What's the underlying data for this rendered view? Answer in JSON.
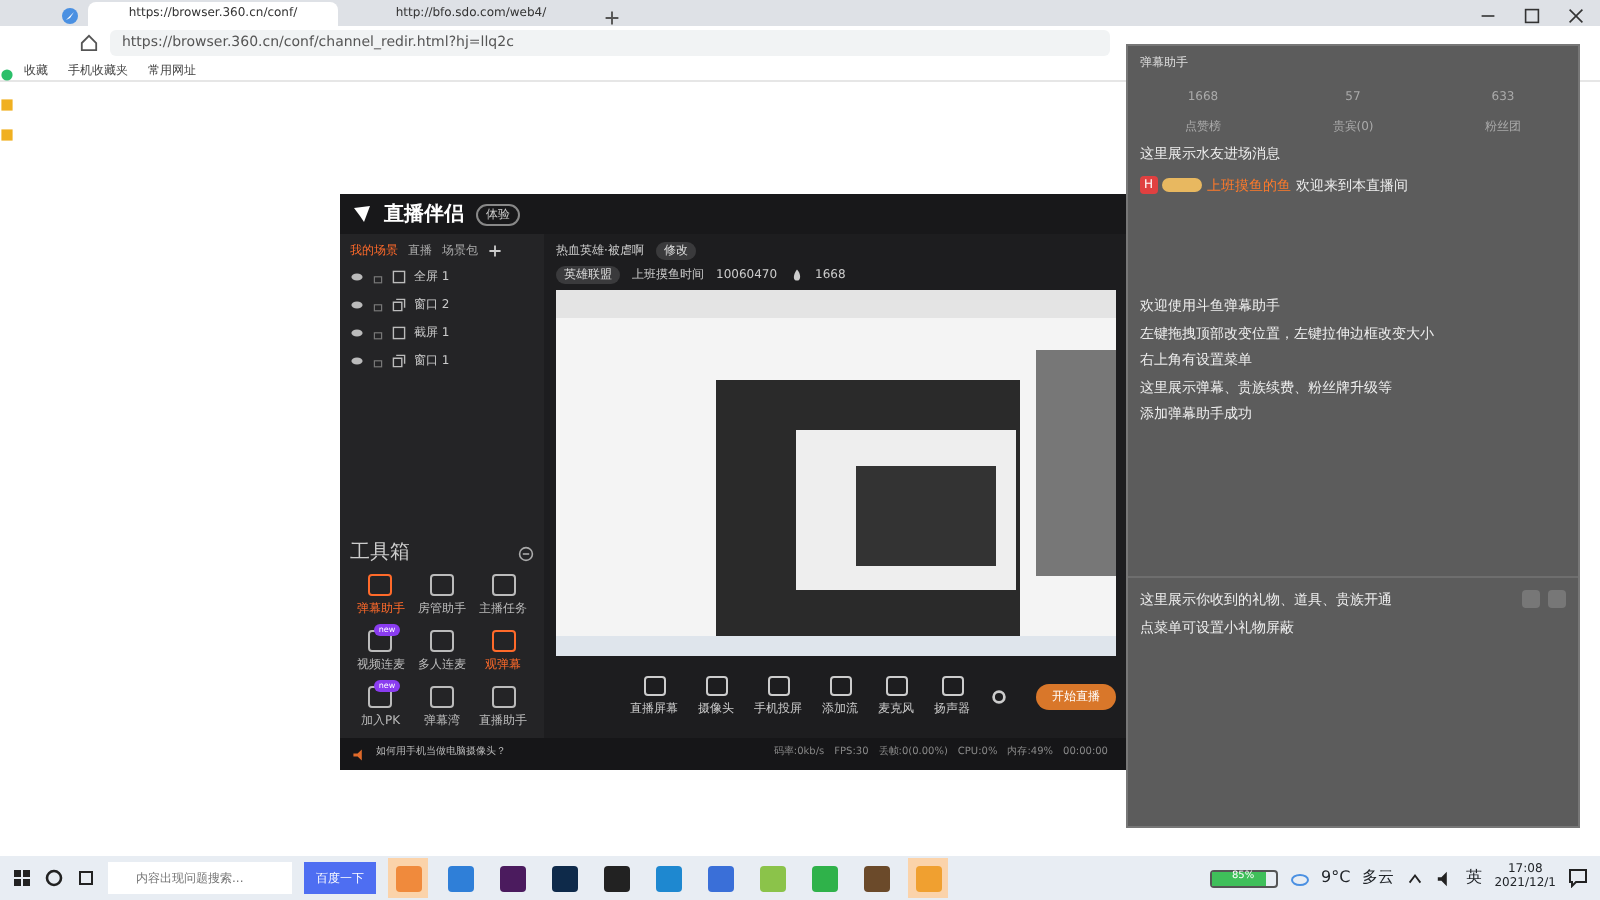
{
  "browser": {
    "tabs": [
      {
        "label": "https://browser.360.cn/conf/",
        "selected": true
      },
      {
        "label": "http://bfo.sdo.com/web4/",
        "selected": false
      }
    ],
    "address": "https://browser.360.cn/conf/channel_redir.html?hj=llq2c",
    "bookmarks": [
      "收藏",
      "手机收藏夹",
      "常用网址"
    ]
  },
  "app": {
    "title": "直播伴侣",
    "title_badge": "体验",
    "scene_tabs": [
      {
        "label": "我的场景",
        "selected": true
      },
      {
        "label": "直播",
        "selected": false
      },
      {
        "label": "场景包",
        "selected": false
      }
    ],
    "sources": [
      {
        "label": "全屏 1",
        "kind": "screen"
      },
      {
        "label": "窗口 2",
        "kind": "window"
      },
      {
        "label": "截屏 1",
        "kind": "screen"
      },
      {
        "label": "窗口 1",
        "kind": "window"
      }
    ],
    "toolbox_title": "工具箱",
    "tools": [
      {
        "label": "弹幕助手",
        "highlight": true
      },
      {
        "label": "房管助手",
        "highlight": false
      },
      {
        "label": "主播任务",
        "highlight": false
      },
      {
        "label": "视频连麦",
        "highlight": false,
        "tag": "new"
      },
      {
        "label": "多人连麦",
        "highlight": false
      },
      {
        "label": "观弹幕",
        "highlight": true
      },
      {
        "label": "加入PK",
        "highlight": false,
        "tag": "new"
      },
      {
        "label": "弹幕湾",
        "highlight": false
      },
      {
        "label": "直播助手",
        "highlight": false
      }
    ],
    "room_title": "热血英雄·被虐啊",
    "edit_tag": "修改",
    "category": "英雄联盟",
    "room_name": "上班摸鱼时间",
    "room_id": "10060470",
    "heat": "1668",
    "bottom_tools": [
      "直播屏幕",
      "摄像头",
      "手机投屏",
      "添加流",
      "麦克风",
      "扬声器"
    ],
    "start_button": "开始直播",
    "tip": "如何用手机当做电脑摄像头？",
    "stats": [
      "码率:0kb/s",
      "FPS:30",
      "丢帧:0(0.00%)",
      "CPU:0%",
      "内存:49%",
      "00:00:00"
    ]
  },
  "overlay": {
    "title": "弹幕助手",
    "counts": [
      {
        "value": "1668",
        "label": "点赞榜"
      },
      {
        "value": "57",
        "label": "贵宾(0)"
      },
      {
        "value": "633",
        "label": "粉丝团"
      }
    ],
    "enter_notice": "这里展示水友进场消息",
    "welcome": {
      "level": "H",
      "user": "上班摸鱼的鱼",
      "text": "欢迎来到本直播间"
    },
    "messages": [
      "欢迎使用斗鱼弹幕助手",
      "左键拖拽顶部改变位置，左键拉伸边框改变大小",
      "右上角有设置菜单",
      "这里展示弹幕、贵族续费、粉丝牌升级等",
      "添加弹幕助手成功"
    ],
    "gift_messages": [
      "这里展示你收到的礼物、道具、贵族开通",
      "点菜单可设置小礼物屏蔽"
    ]
  },
  "taskbar": {
    "search_placeholder": "内容出现问题搜索...",
    "search_button": "百度一下",
    "apps": [
      {
        "color": "#f08a3c",
        "active": true
      },
      {
        "color": "#2f7fd8",
        "active": false
      },
      {
        "color": "#4b1b5e",
        "active": false
      },
      {
        "color": "#0e2a4a",
        "active": false
      },
      {
        "color": "#222222",
        "active": false
      },
      {
        "color": "#1e88d0",
        "active": false
      },
      {
        "color": "#3a6fd8",
        "active": false
      },
      {
        "color": "#8bc34a",
        "active": false
      },
      {
        "color": "#2fb24a",
        "active": false
      },
      {
        "color": "#6b4a2a",
        "active": false
      },
      {
        "color": "#f0a030",
        "active": true
      }
    ],
    "battery": "85%",
    "level": 0.85,
    "temperature": "9°C",
    "weather": "多云",
    "ime": "英",
    "time": "17:08",
    "date": "2021/12/1"
  }
}
